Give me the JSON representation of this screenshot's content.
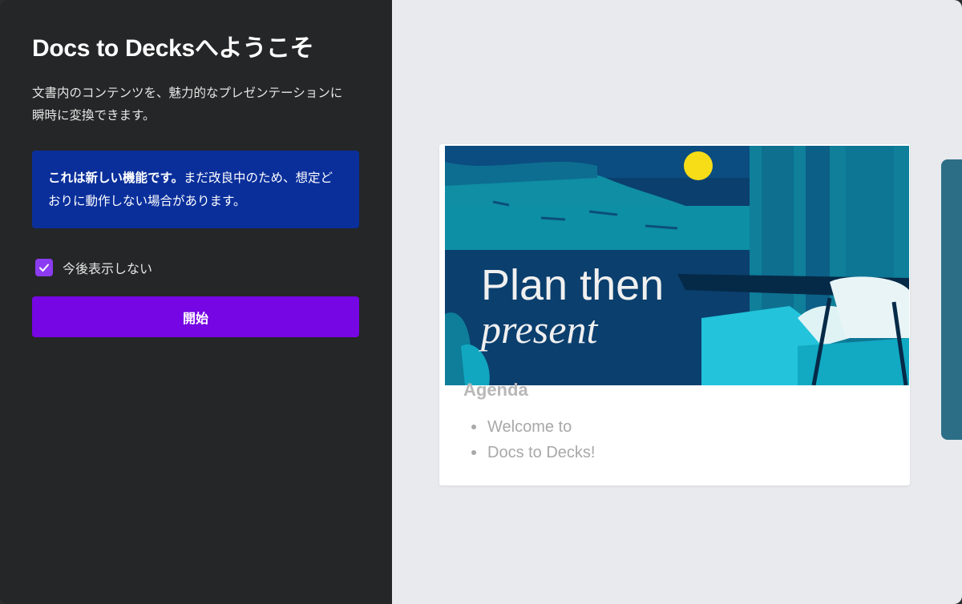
{
  "dialog": {
    "title": "Docs to Decksへようこそ",
    "description": "文書内のコンテンツを、魅力的なプレゼンテーションに瞬時に変換できます。",
    "notice": {
      "bold": "これは新しい機能です。",
      "text": "まだ改良中のため、想定どおりに動作しない場合があります。"
    },
    "checkbox": {
      "label": "今後表示しない",
      "checked": true
    },
    "start_button": "開始"
  },
  "preview": {
    "banner_line1": "Plan then",
    "banner_line2": "present",
    "agenda_title": "Agenda",
    "bullets": [
      "Welcome to",
      "Docs to Decks!"
    ]
  },
  "colors": {
    "left_bg": "#252627",
    "notice_bg": "#0a2f9b",
    "accent_purple": "#7606e3",
    "checkbox": "#8b3cf2",
    "right_bg": "#e8eaed"
  }
}
